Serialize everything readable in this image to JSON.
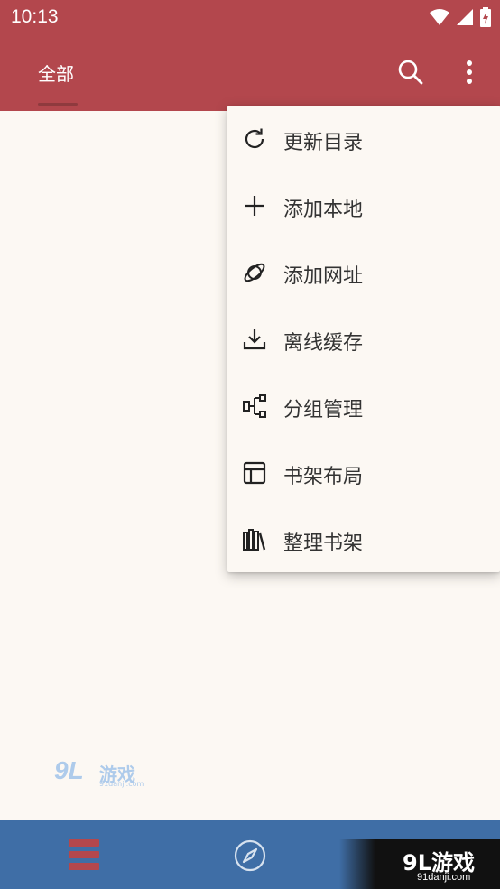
{
  "status_bar": {
    "time": "10:13"
  },
  "app_bar": {
    "tab_label": "全部"
  },
  "menu": {
    "items": [
      {
        "label": "更新目录",
        "icon": "refresh-icon"
      },
      {
        "label": "添加本地",
        "icon": "plus-icon"
      },
      {
        "label": "添加网址",
        "icon": "planet-icon"
      },
      {
        "label": "离线缓存",
        "icon": "download-icon"
      },
      {
        "label": "分组管理",
        "icon": "group-icon"
      },
      {
        "label": "书架布局",
        "icon": "layout-icon"
      },
      {
        "label": "整理书架",
        "icon": "books-icon"
      }
    ]
  },
  "watermark": {
    "brand": "9L",
    "name": "游戏",
    "url": "91danji.com"
  },
  "corner_badge": {
    "brand": "9L游戏",
    "url": "91danji.com"
  },
  "colors": {
    "primary": "#b3474d",
    "nav": "#3f6ea6",
    "background": "#fcf8f3"
  }
}
